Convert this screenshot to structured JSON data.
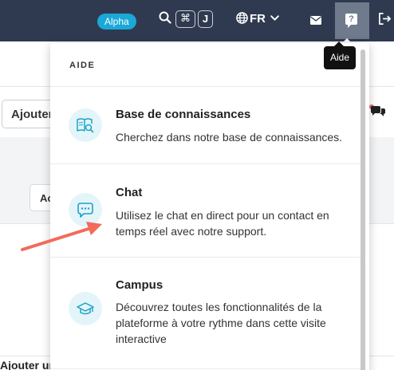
{
  "topbar": {
    "badge": "Alpha",
    "search_icon": "search-icon",
    "shortcut_keys": [
      "⌘",
      "J"
    ],
    "language": "FR",
    "icons": [
      "globe-icon",
      "chevron-down-icon",
      "mail-icon",
      "help-icon",
      "logout-icon"
    ]
  },
  "tooltip": "Aide",
  "background": {
    "add_button": "Ajouter",
    "second_button": "Ac",
    "bottom_text": "Ajouter un w"
  },
  "help_menu": {
    "header": "AIDE",
    "items": [
      {
        "title": "Base de connaissances",
        "description": "Cherchez dans notre base de connaissances.",
        "icon": "book-search-icon"
      },
      {
        "title": "Chat",
        "description": "Utilisez le chat en direct pour un contact en temps réel avec notre support.",
        "icon": "chat-bubble-icon"
      },
      {
        "title": "Campus",
        "description": "Découvrez toutes les fonctionnalités de la plateforme à votre rythme dans cette visite interactive",
        "icon": "graduation-cap-icon"
      }
    ]
  },
  "colors": {
    "topbar": "#2f3a50",
    "badge": "#1aa8d6",
    "icon_accent": "#1ba3c6",
    "icon_bg": "#e4f5fa",
    "arrow": "#f26b5b"
  }
}
